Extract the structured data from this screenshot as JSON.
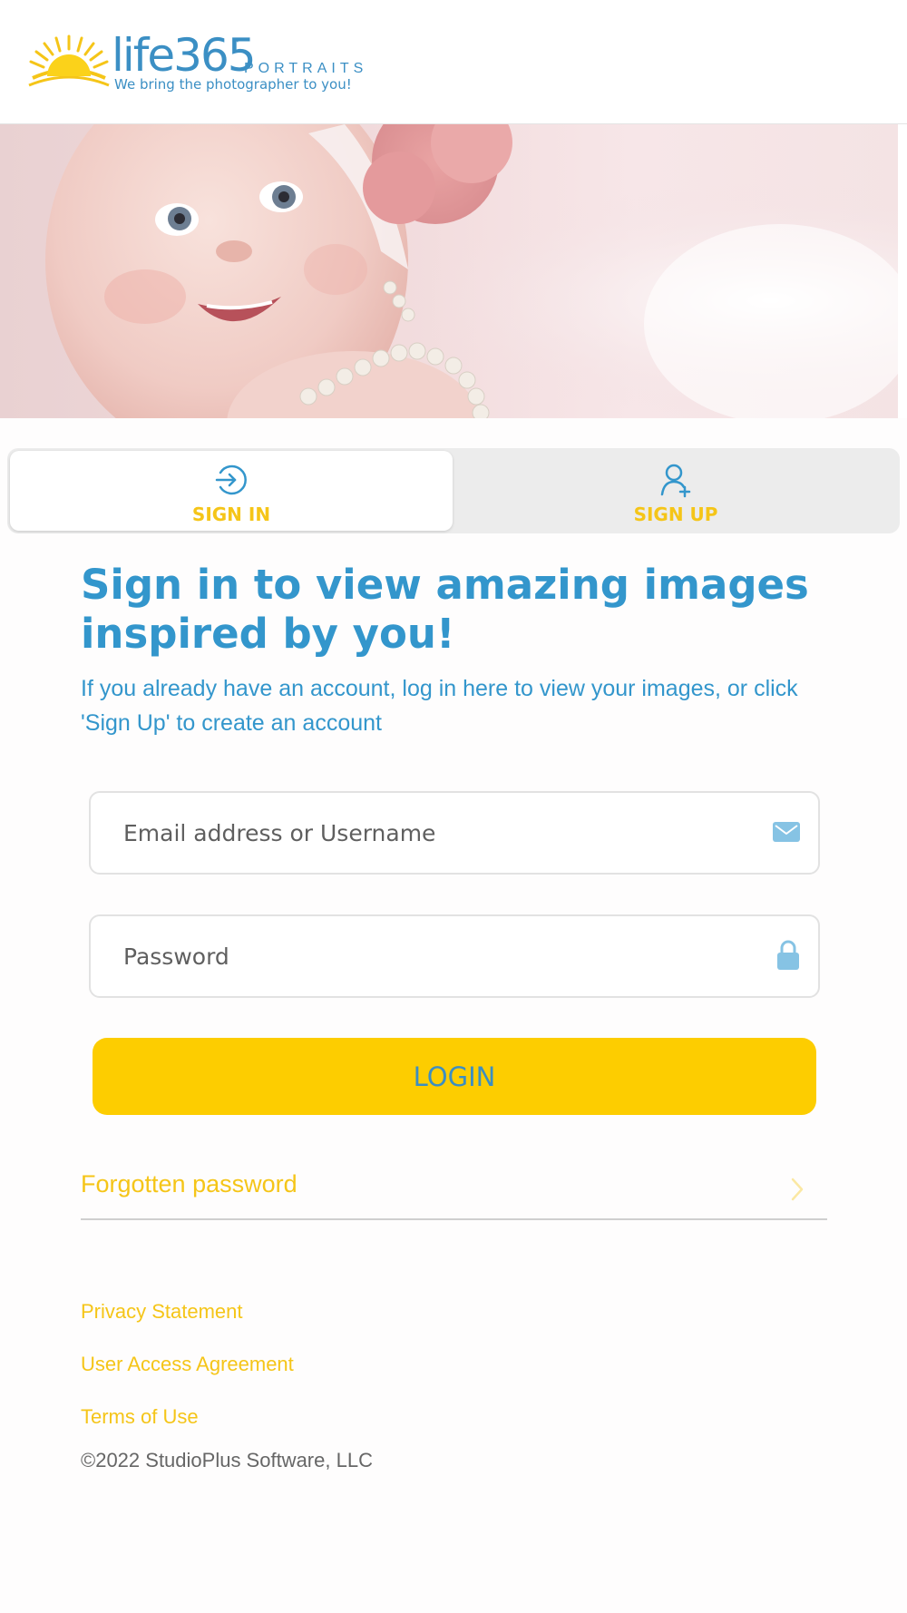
{
  "header": {
    "logo_word": "life365",
    "logo_tm": "™",
    "logo_portraits": "PORTRAITS",
    "logo_tagline": "We bring the photographer to you!"
  },
  "hero": {
    "image": "baby-portrait-photo"
  },
  "tabs": [
    {
      "label": "SIGN IN",
      "icon": "sign-in-icon",
      "active": true
    },
    {
      "label": "SIGN UP",
      "icon": "add-user-icon",
      "active": false
    }
  ],
  "main": {
    "heading": "Sign in to view amazing images inspired by you!",
    "subtext": "If you already have an account, log in here to view your images, or click 'Sign Up' to create an account"
  },
  "form": {
    "email_placeholder": "Email address or Username",
    "email_value": "",
    "email_icon": "envelope-icon",
    "password_placeholder": "Password",
    "password_value": "",
    "password_icon": "lock-icon",
    "login_label": "LOGIN",
    "forgot_label": "Forgotten password"
  },
  "footer": {
    "links": [
      "Privacy Statement",
      "User Access Agreement",
      "Terms of Use"
    ],
    "copyright": "©2022 StudioPlus Software, LLC"
  },
  "colors": {
    "brand_blue": "#3396cc",
    "brand_yellow": "#fdcd00",
    "link_yellow": "#f5c518"
  }
}
